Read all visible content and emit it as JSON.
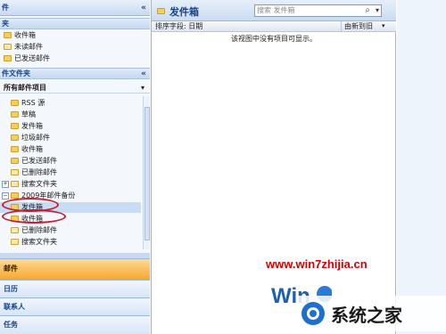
{
  "nav": {
    "title": "件",
    "collapse_glyph": "«",
    "fav_section": "夹",
    "fav_items": [
      "收件箱",
      "未读邮件",
      "已发送邮件"
    ],
    "folders_section": "件文件夹",
    "all_items": "所有邮件项目",
    "tree": [
      {
        "label": "RSS 源"
      },
      {
        "label": "草稿"
      },
      {
        "label": "发件箱"
      },
      {
        "label": "垃圾邮件"
      },
      {
        "label": "收件箱"
      },
      {
        "label": "已发送邮件"
      },
      {
        "label": "已删除邮件"
      },
      {
        "label": "搜索文件夹"
      }
    ],
    "backup_root": "2009年邮件备份",
    "backup_items": [
      "发件箱",
      "收件箱",
      "已删除邮件",
      "搜索文件夹"
    ],
    "buttons": [
      "邮件",
      "日历",
      "联系人",
      "任务"
    ]
  },
  "main": {
    "folder_title": "发件箱",
    "search_placeholder": "搜索 发件箱",
    "search_icon": "⌕",
    "dropdown_glyph": "▾",
    "sort_label": "排序字段: 日期",
    "sort_order": "由新到旧",
    "empty_message": "该视图中没有项目可显示。"
  },
  "watermark": {
    "url": "www.win7zhijia.cn",
    "brand": "系统之家"
  },
  "colors": {
    "accent": "#15428b",
    "active_button": "#f7a72f",
    "highlight_ring": "#c81e2e",
    "watermark_red": "#d40000"
  }
}
